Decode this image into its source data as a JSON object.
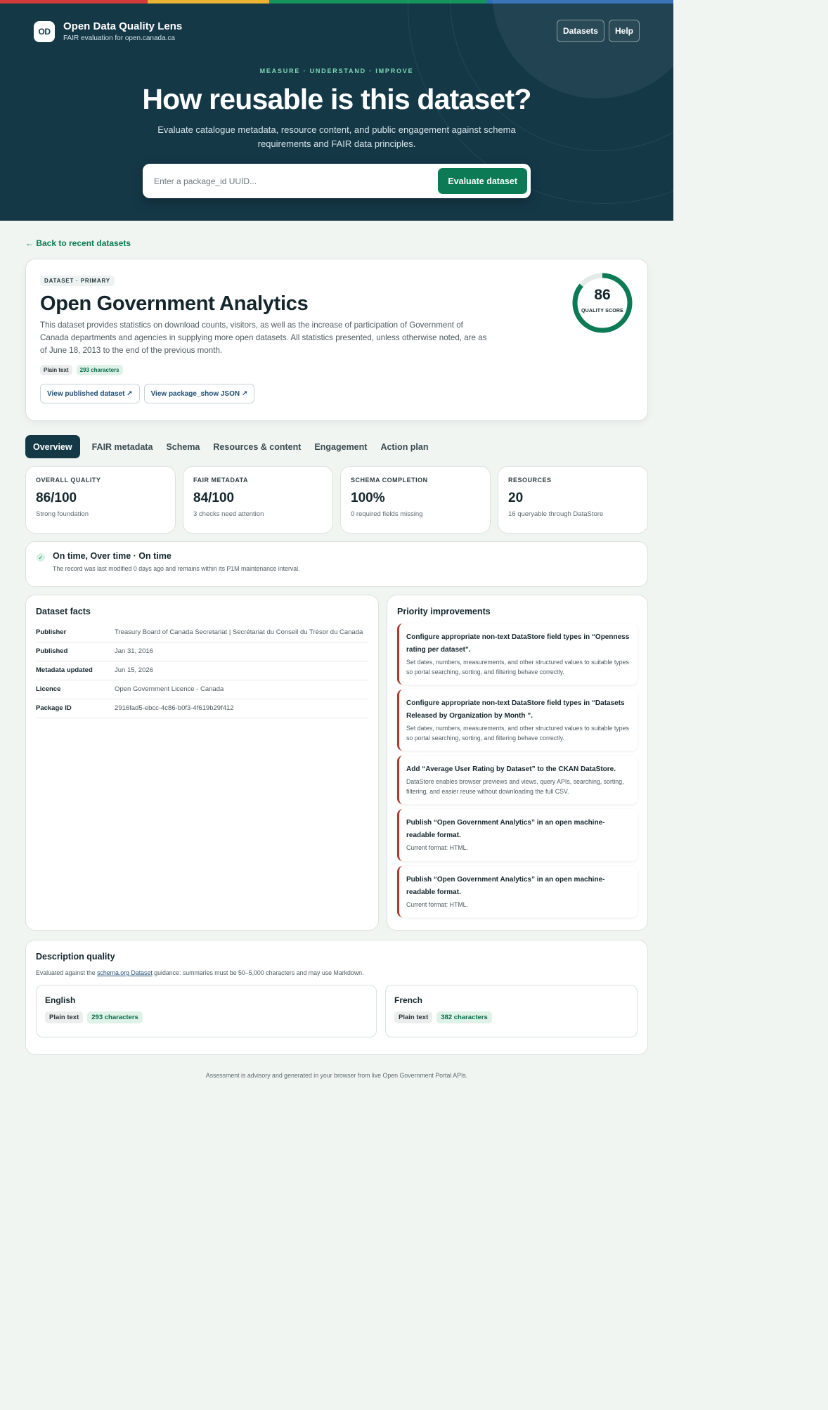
{
  "colors": {
    "hero_bg": "#153847",
    "accent_green": "#0c7a55",
    "priority_border": "#b23a2f",
    "topbar": [
      "#d33b3b",
      "#e8b431",
      "#14955b",
      "#2f6db5"
    ]
  },
  "brand": {
    "logo_text": "OD",
    "title": "Open Data Quality Lens",
    "subtitle": "FAIR evaluation for open.canada.ca"
  },
  "nav": {
    "datasets": "Datasets",
    "help": "Help"
  },
  "hero": {
    "eyebrow": "MEASURE · UNDERSTAND · IMPROVE",
    "title": "How reusable is this dataset?",
    "description": "Evaluate catalogue metadata, resource content, and public engagement against schema requirements and FAIR data principles."
  },
  "search": {
    "placeholder": "Enter a package_id UUID...",
    "value": "",
    "button": "Evaluate dataset"
  },
  "back_link": "← Back to recent datasets",
  "dataset": {
    "label": "DATASET · PRIMARY",
    "title": "Open Government Analytics",
    "description": "This dataset provides statistics on download counts, visitors, as well as the increase of participation of Government of Canada departments and agencies in supplying more open datasets. All statistics presented, unless otherwise noted, are as of June 18, 2013 to the end of the previous month.",
    "chip_format": "Plain text",
    "chip_length": "293 characters",
    "view_published": "View published dataset ↗",
    "view_json": "View package_show JSON ↗",
    "score": "86",
    "score_fraction": 0.86,
    "score_label": "QUALITY SCORE"
  },
  "tabs": [
    {
      "label": "Overview",
      "active": true
    },
    {
      "label": "FAIR metadata"
    },
    {
      "label": "Schema"
    },
    {
      "label": "Resources & content"
    },
    {
      "label": "Engagement"
    },
    {
      "label": "Action plan"
    }
  ],
  "metrics": [
    {
      "label": "OVERALL QUALITY",
      "value": "86/100",
      "sub": "Strong foundation"
    },
    {
      "label": "FAIR METADATA",
      "value": "84/100",
      "sub": "3 checks need attention"
    },
    {
      "label": "SCHEMA COMPLETION",
      "value": "100%",
      "sub": "0 required fields missing"
    },
    {
      "label": "RESOURCES",
      "value": "20",
      "sub": "16 queryable through DataStore"
    }
  ],
  "status": {
    "icon": "check-icon",
    "check_glyph": "✓",
    "title": "On time, Over time · On time",
    "text": "The record was last modified 0 days ago and remains within its P1M maintenance interval."
  },
  "facts": {
    "title": "Dataset facts",
    "rows": [
      {
        "key": "Publisher",
        "value": "Treasury Board of Canada Secretariat | Secrétariat du Conseil du Trésor du Canada"
      },
      {
        "key": "Published",
        "value": "Jan 31, 2016"
      },
      {
        "key": "Metadata updated",
        "value": "Jun 15, 2026"
      },
      {
        "key": "Licence",
        "value": "Open Government Licence - Canada"
      },
      {
        "key": "Package ID",
        "value": "2916fad5-ebcc-4c86-b0f3-4f619b29f412"
      }
    ]
  },
  "priorities": {
    "title": "Priority improvements",
    "items": [
      {
        "title": "Configure appropriate non-text DataStore field types in “Openness rating per dataset”.",
        "body": "Set dates, numbers, measurements, and other structured values to suitable types so portal searching, sorting, and filtering behave correctly."
      },
      {
        "title": "Configure appropriate non-text DataStore field types in “Datasets Released by Organization by Month ”.",
        "body": "Set dates, numbers, measurements, and other structured values to suitable types so portal searching, sorting, and filtering behave correctly."
      },
      {
        "title": "Add “Average User Rating by Dataset” to the CKAN DataStore.",
        "body": "DataStore enables browser previews and views, query APIs, searching, sorting, filtering, and easier reuse without downloading the full CSV."
      },
      {
        "title": "Publish “Open Government Analytics” in an open machine-readable format.",
        "body": "Current format: HTML."
      },
      {
        "title": "Publish “Open Government Analytics” in an open machine-readable format.",
        "body": "Current format: HTML."
      }
    ]
  },
  "description_quality": {
    "title": "Description quality",
    "sub_before": "Evaluated against the ",
    "sub_link": "schema.org Dataset",
    "sub_after": " guidance: summaries must be 50–5,000 characters and may use Markdown.",
    "english": {
      "name": "English",
      "format": "Plain text",
      "length": "293 characters"
    },
    "french": {
      "name": "French",
      "format": "Plain text",
      "length": "382 characters"
    }
  },
  "footer": "Assessment is advisory and generated in your browser from live Open Government Portal APIs."
}
